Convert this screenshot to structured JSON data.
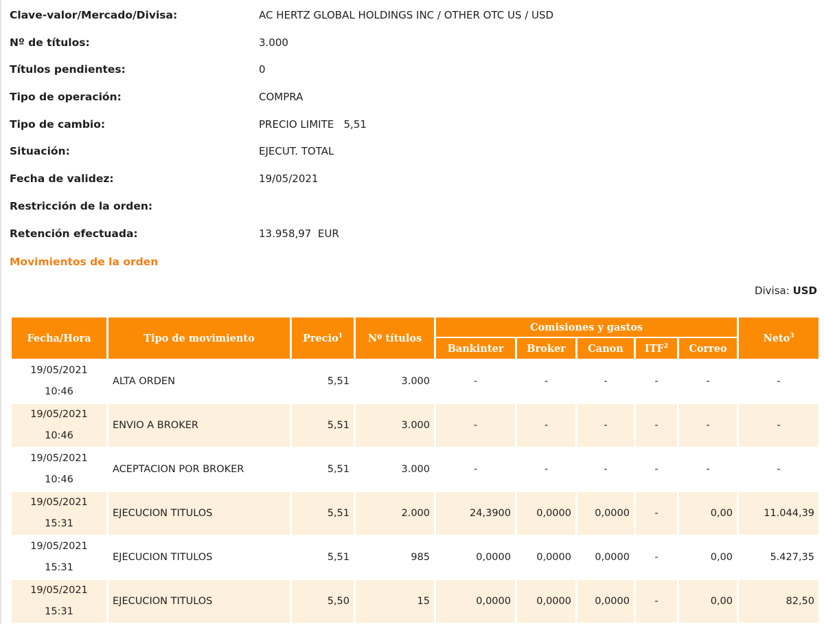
{
  "details": [
    {
      "label": "Clave-valor/Mercado/Divisa:",
      "value": "AC HERTZ GLOBAL HOLDINGS INC / OTHER OTC US / USD"
    },
    {
      "label": "Nº de títulos:",
      "value": "3.000"
    },
    {
      "label": "Títulos pendientes:",
      "value": "0"
    },
    {
      "label": "Tipo de operación:",
      "value": "COMPRA"
    },
    {
      "label": "Tipo de cambio:",
      "value": "PRECIO LIMITE   5,51"
    },
    {
      "label": "Situación:",
      "value": "EJECUT. TOTAL"
    },
    {
      "label": "Fecha de validez:",
      "value": "19/05/2021"
    },
    {
      "label": "Restricción de la orden:",
      "value": ""
    },
    {
      "label": "Retención efectuada:",
      "value": "13.958,97  EUR"
    }
  ],
  "section_title": "Movimientos de la orden",
  "currency": {
    "label": "Divisa:",
    "value": "USD"
  },
  "table": {
    "headers": {
      "fecha_hora": "Fecha/Hora",
      "tipo_movimiento": "Tipo de movimiento",
      "precio": "Precio",
      "precio_sup": "1",
      "n_titulos": "Nº títulos",
      "comisiones": "Comisiones y gastos",
      "bankinter": "Bankinter",
      "broker": "Broker",
      "canon": "Canon",
      "itf": "ITF",
      "itf_sup": "2",
      "correo": "Correo",
      "neto": "Neto",
      "neto_sup": "3"
    },
    "rows": [
      {
        "date": "19/05/2021",
        "time": "10:46",
        "type": "ALTA ORDEN",
        "precio": "5,51",
        "titulos": "3.000",
        "bankinter": "-",
        "broker": "-",
        "canon": "-",
        "itf": "-",
        "correo": "-",
        "neto": "-"
      },
      {
        "date": "19/05/2021",
        "time": "10:46",
        "type": "ENVIO A BROKER",
        "precio": "5,51",
        "titulos": "3.000",
        "bankinter": "-",
        "broker": "-",
        "canon": "-",
        "itf": "-",
        "correo": "-",
        "neto": "-"
      },
      {
        "date": "19/05/2021",
        "time": "10:46",
        "type": "ACEPTACION POR BROKER",
        "precio": "5,51",
        "titulos": "3.000",
        "bankinter": "-",
        "broker": "-",
        "canon": "-",
        "itf": "-",
        "correo": "-",
        "neto": "-"
      },
      {
        "date": "19/05/2021",
        "time": "15:31",
        "type": "EJECUCION TITULOS",
        "precio": "5,51",
        "titulos": "2.000",
        "bankinter": "24,3900",
        "broker": "0,0000",
        "canon": "0,0000",
        "itf": "-",
        "correo": "0,00",
        "neto": "11.044,39"
      },
      {
        "date": "19/05/2021",
        "time": "15:31",
        "type": "EJECUCION TITULOS",
        "precio": "5,51",
        "titulos": "985",
        "bankinter": "0,0000",
        "broker": "0,0000",
        "canon": "0,0000",
        "itf": "-",
        "correo": "0,00",
        "neto": "5.427,35"
      },
      {
        "date": "19/05/2021",
        "time": "15:31",
        "type": "EJECUCION TITULOS",
        "precio": "5,50",
        "titulos": "15",
        "bankinter": "0,0000",
        "broker": "0,0000",
        "canon": "0,0000",
        "itf": "-",
        "correo": "0,00",
        "neto": "82,50"
      }
    ]
  }
}
